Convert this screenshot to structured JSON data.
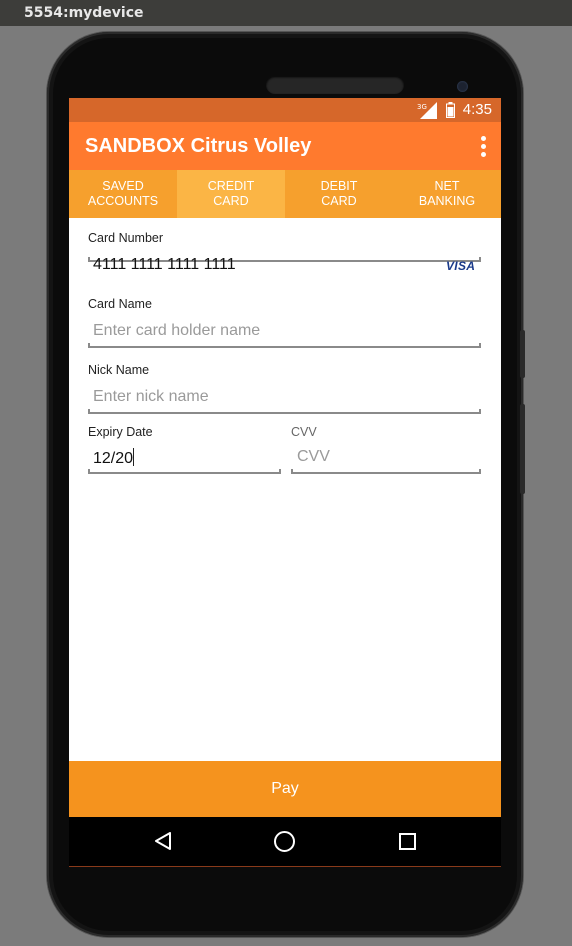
{
  "window": {
    "title": "5554:mydevice"
  },
  "status_bar": {
    "time": "4:35",
    "network_type": "3G",
    "icons": [
      "signal-icon",
      "battery-icon"
    ]
  },
  "app_bar": {
    "title": "SANDBOX Citrus Volley",
    "menu_icon": "overflow-menu-icon"
  },
  "tabs": [
    {
      "label": "SAVED\nACCOUNTS",
      "active": false
    },
    {
      "label": "CREDIT\nCARD",
      "active": true
    },
    {
      "label": "DEBIT\nCARD",
      "active": false
    },
    {
      "label": "NET\nBANKING",
      "active": false
    }
  ],
  "form": {
    "card_number": {
      "label": "Card Number",
      "value": "4111 1111 1111 1111",
      "brand": "VISA"
    },
    "card_name": {
      "label": "Card Name",
      "placeholder": "Enter card holder name"
    },
    "nick_name": {
      "label": "Nick Name",
      "placeholder": "Enter nick name"
    },
    "expiry": {
      "label": "Expiry Date",
      "value": "12/20"
    },
    "cvv": {
      "label": "CVV",
      "placeholder": "CVV"
    }
  },
  "pay_button": {
    "label": "Pay"
  },
  "colors": {
    "status_bar": "#d6672a",
    "app_bar": "#ff7a2e",
    "tabs": "#f6a02d",
    "active_tab": "#fbb545",
    "pay_button": "#f5931e"
  }
}
